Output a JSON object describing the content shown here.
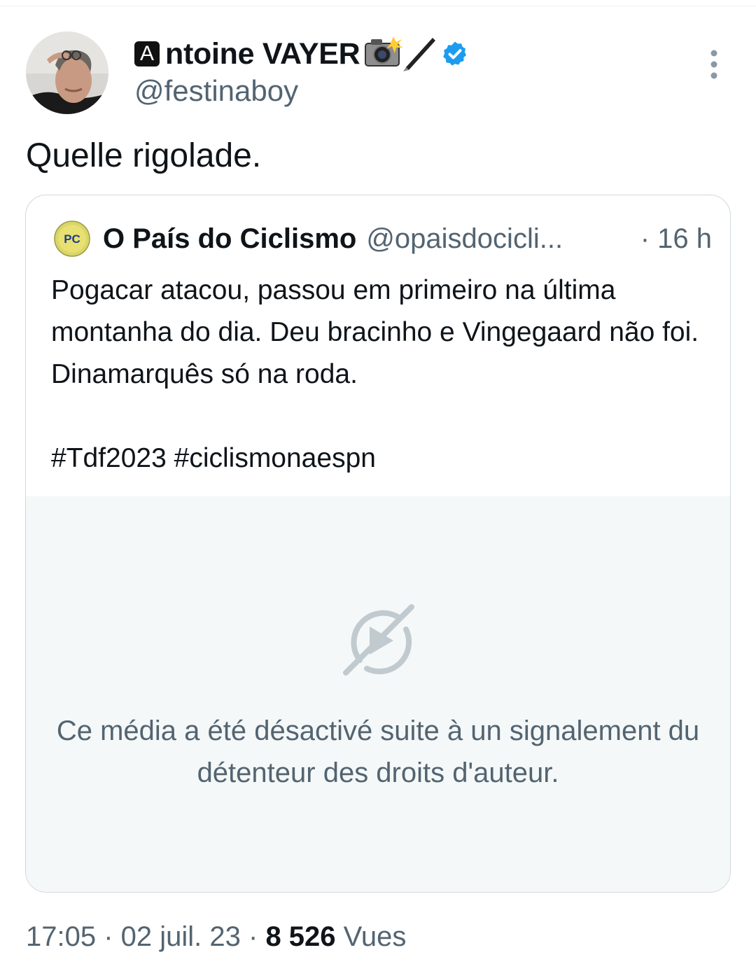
{
  "author": {
    "name_badge_letter": "A",
    "display_name": "ntoine VAYER",
    "name_emojis": "📸🖋️",
    "handle": "@festinaboy",
    "verified_color": "#1d9bf0"
  },
  "tweet": {
    "text": "Quelle rigolade."
  },
  "quote": {
    "display_name": "O País do Ciclismo",
    "handle": "@opaisdocicli...",
    "time": "· 16 h",
    "body": "Pogacar atacou, passou em primeiro na última montanha do dia. Deu bracinho e Vingegaard não foi. Dinamarquês só na roda.",
    "hashtags": "#Tdf2023 #ciclismonaespn",
    "avatar_text": "PC",
    "media_notice": "Ce média a été désactivé suite à un signalement du détenteur des droits d'auteur.",
    "media_icon": "disabled-video-icon"
  },
  "meta": {
    "time": "17:05",
    "sep1": " · ",
    "date": "02 juil. 23",
    "sep2": " · ",
    "views_count": "8 526",
    "views_label": " Vues"
  },
  "colors": {
    "text_primary": "#0f1419",
    "text_secondary": "#536471",
    "border": "#cfd9de",
    "media_bg": "#f5f8f8"
  }
}
